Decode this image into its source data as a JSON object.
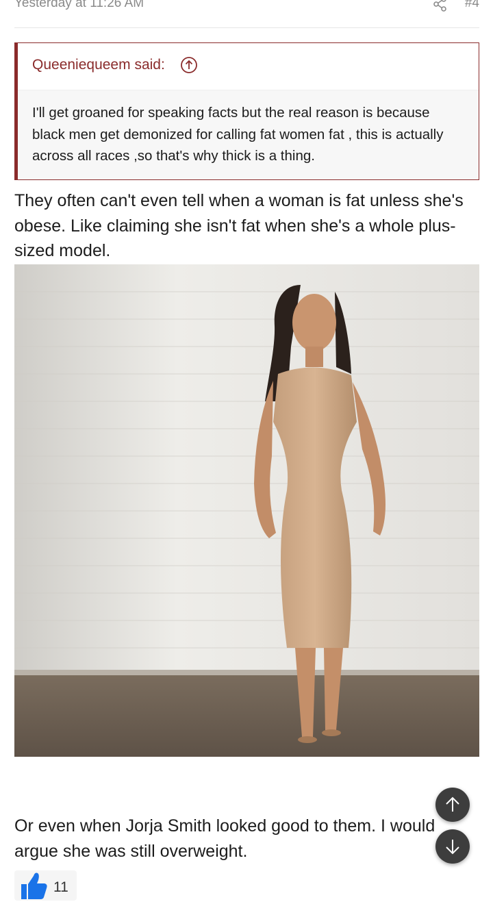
{
  "post": {
    "date": "Yesterday at 11:26 AM",
    "number": "#4",
    "share_icon": "share-icon"
  },
  "quote": {
    "author_label": "Queeniequeem said:",
    "jump_icon": "arrow-up-circle-icon",
    "body": "I'll get groaned for speaking facts but the real reason is because black men get demonized for calling fat women fat , this is actually across all races ,so that's why thick is a thing."
  },
  "content": {
    "paragraph1": "They often can't even tell when a woman is fat unless she's obese. Like claiming she isn't fat when she's a whole plus-sized model.",
    "paragraph2": "Or even when Jorja Smith looked good to them. I would argue she was still overweight."
  },
  "reactions": {
    "icon": "thumbs-up-icon",
    "count": "11"
  },
  "navigation": {
    "scroll_up_icon": "arrow-up-icon",
    "scroll_down_icon": "arrow-down-icon"
  },
  "colors": {
    "quote_accent": "#8a2b2b",
    "muted_text": "#8a8a8a",
    "like_blue": "#1a73e8",
    "scroll_button": "#3d3d3d"
  }
}
